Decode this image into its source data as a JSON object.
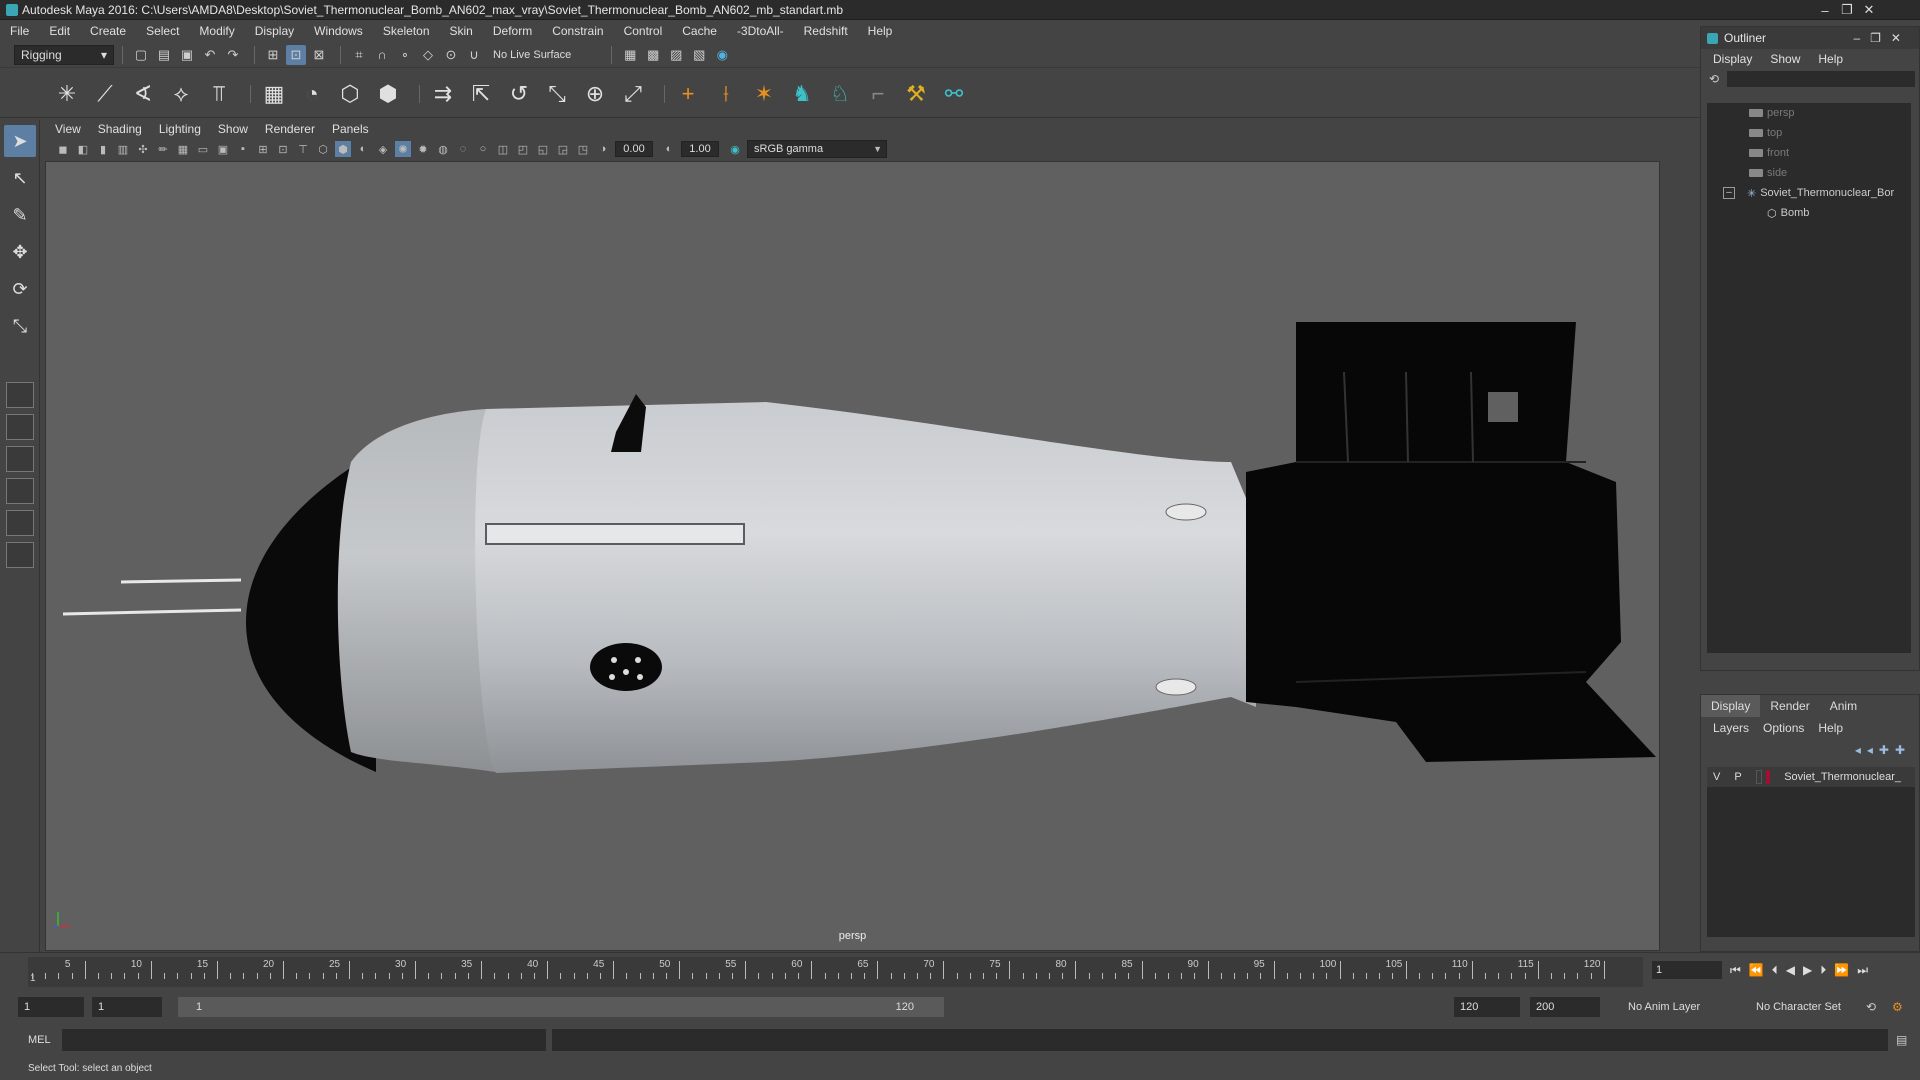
{
  "window": {
    "title": "Autodesk Maya 2016: C:\\Users\\AMDA8\\Desktop\\Soviet_Thermonuclear_Bomb_AN602_max_vray\\Soviet_Thermonuclear_Bomb_AN602_mb_standart.mb",
    "controls": [
      "–",
      "❐",
      "✕"
    ]
  },
  "menubar": {
    "items": [
      "File",
      "Edit",
      "Create",
      "Select",
      "Modify",
      "Display",
      "Windows",
      "Skeleton",
      "Skin",
      "Deform",
      "Constrain",
      "Control",
      "Cache",
      "-3DtoAll-",
      "Redshift",
      "Help"
    ]
  },
  "statusline": {
    "menuset": "Rigging",
    "live_surface": "No Live Surface"
  },
  "panel": {
    "menu": [
      "View",
      "Shading",
      "Lighting",
      "Show",
      "Renderer",
      "Panels"
    ],
    "exposure": "0.00",
    "gamma_value": "1.00",
    "color_space": "sRGB gamma"
  },
  "viewport": {
    "camera_label": "persp"
  },
  "outliner": {
    "title": "Outliner",
    "menu": [
      "Display",
      "Show",
      "Help"
    ],
    "items": [
      {
        "label": "persp",
        "dim": true
      },
      {
        "label": "top",
        "dim": true
      },
      {
        "label": "front",
        "dim": true
      },
      {
        "label": "side",
        "dim": true
      },
      {
        "label": "Soviet_Thermonuclear_Bor",
        "dim": false
      },
      {
        "label": "Bomb",
        "dim": false
      }
    ]
  },
  "layer_editor": {
    "tabs": [
      "Display",
      "Render",
      "Anim"
    ],
    "menu": [
      "Layers",
      "Options",
      "Help"
    ],
    "layer": {
      "v": "V",
      "p": "P",
      "name": "Soviet_Thermonuclear_",
      "color": "#a01030"
    }
  },
  "timeline": {
    "ticks": [
      "5",
      "10",
      "15",
      "20",
      "25",
      "30",
      "35",
      "40",
      "45",
      "50",
      "55",
      "60",
      "65",
      "70",
      "75",
      "80",
      "85",
      "90",
      "95",
      "100",
      "105",
      "110",
      "115",
      "120"
    ],
    "start_marker": "1",
    "current_frame": "1"
  },
  "range": {
    "start": "1",
    "range_start": "1",
    "bar_start": "1",
    "bar_end": "120",
    "range_end": "120",
    "end": "200",
    "anim_layer": "No Anim Layer",
    "character_set": "No Character Set"
  },
  "command": {
    "lang": "MEL"
  },
  "helpline": {
    "text": "Select Tool: select an object"
  }
}
